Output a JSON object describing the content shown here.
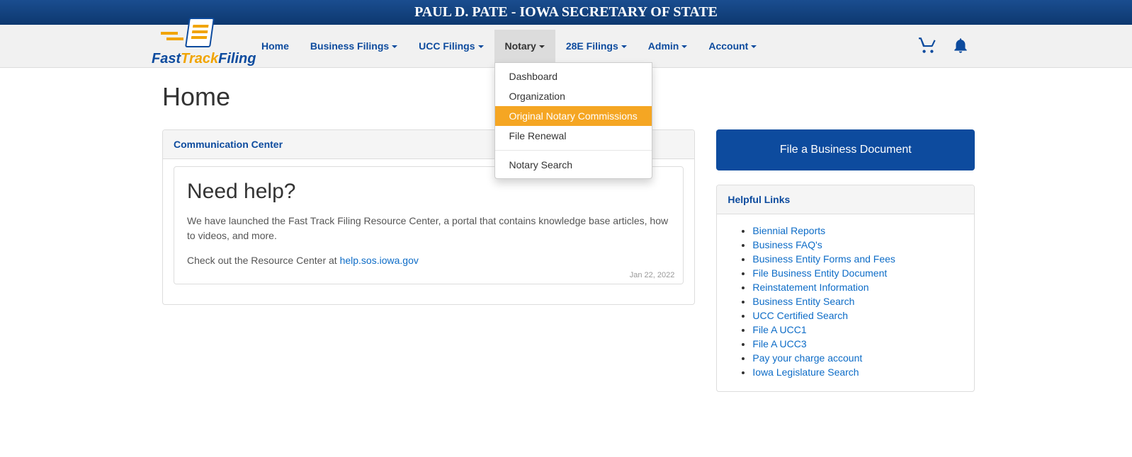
{
  "banner": {
    "text": "PAUL D. PATE - IOWA SECRETARY OF STATE"
  },
  "logo": {
    "word1": "Fast",
    "word2": "Track",
    "word3": "Filing"
  },
  "nav": {
    "home": "Home",
    "business_filings": "Business Filings",
    "ucc_filings": "UCC Filings",
    "notary": "Notary",
    "e28_filings": "28E Filings",
    "admin": "Admin",
    "account": "Account"
  },
  "notary_menu": {
    "dashboard": "Dashboard",
    "organization": "Organization",
    "original_commissions": "Original Notary Commissions",
    "file_renewal": "File Renewal",
    "notary_search": "Notary Search"
  },
  "page": {
    "title": "Home"
  },
  "comm_center": {
    "heading": "Communication Center",
    "card_title": "Need help?",
    "para1": "We have launched the Fast Track Filing Resource Center, a portal that contains knowledge base articles, how to videos, and more.",
    "para2_prefix": "Check out the Resource Center at ",
    "para2_link": "help.sos.iowa.gov",
    "date": "Jan 22, 2022"
  },
  "cta": {
    "label": "File a Business Document"
  },
  "helpful": {
    "heading": "Helpful Links",
    "links": [
      "Biennial Reports",
      "Business FAQ's",
      "Business Entity Forms and Fees",
      "File Business Entity Document",
      "Reinstatement Information",
      "Business Entity Search",
      "UCC Certified Search",
      "File A UCC1",
      "File A UCC3",
      "Pay your charge account",
      "Iowa Legislature Search"
    ]
  }
}
